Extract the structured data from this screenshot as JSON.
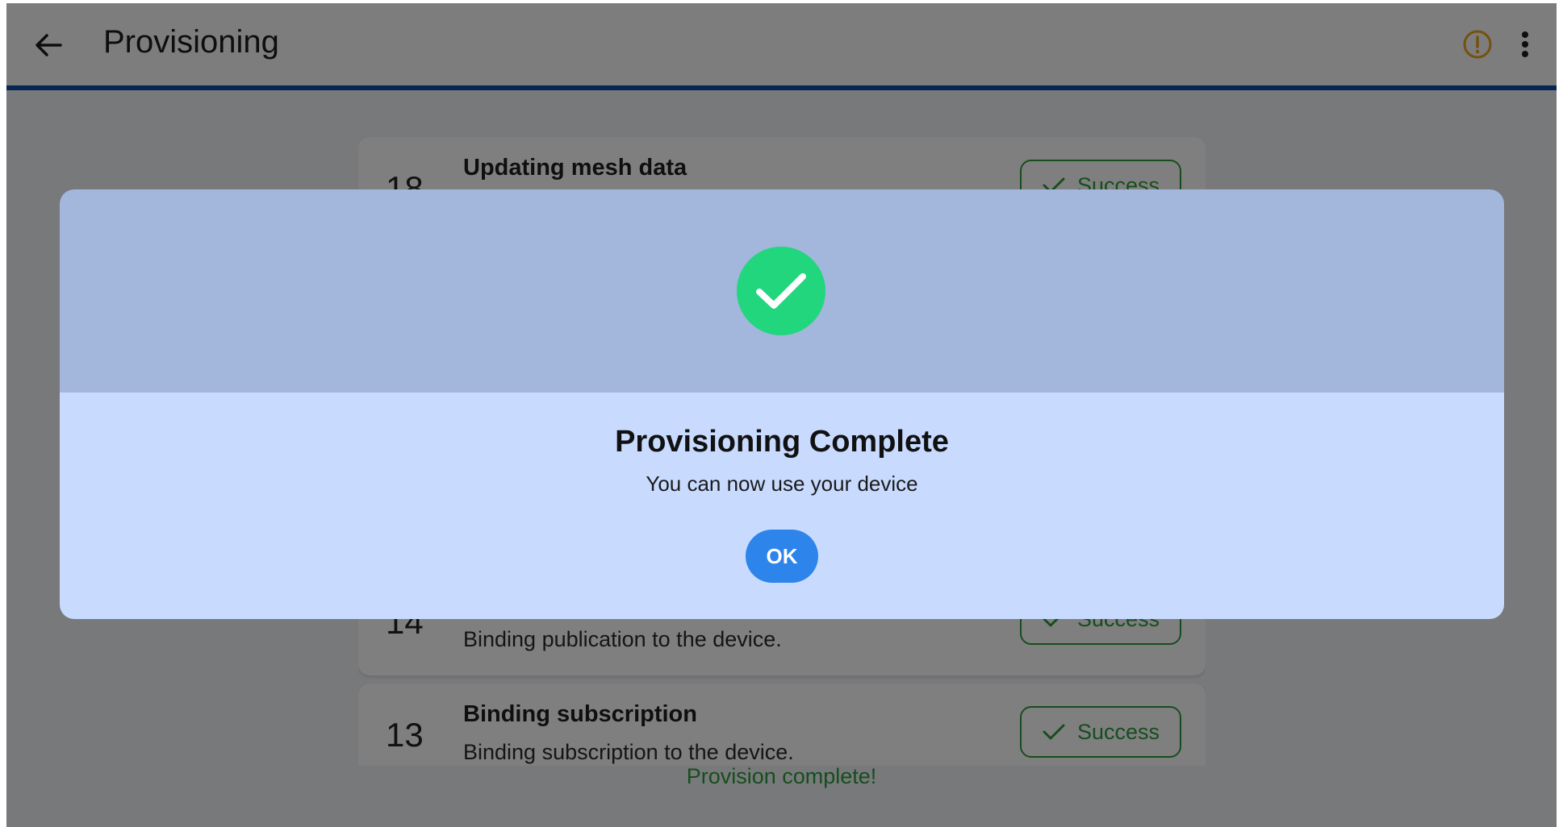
{
  "appbar": {
    "title": "Provisioning",
    "back_icon": "arrow-left-icon",
    "warning_icon": "warning-circle-icon",
    "more_icon": "more-vert-icon"
  },
  "steps": [
    {
      "number": "18",
      "title": "Updating mesh data",
      "subtitle": "",
      "status": "Success"
    },
    {
      "number": "14",
      "title": "",
      "subtitle": "Binding publication to the device.",
      "status": "Success"
    },
    {
      "number": "13",
      "title": "Binding subscription",
      "subtitle": "Binding subscription to the device.",
      "status": "Success"
    }
  ],
  "footer": {
    "status_text": "Provision complete!"
  },
  "dialog": {
    "icon": "check-circle-icon",
    "title": "Provisioning Complete",
    "message": "You can now use your device",
    "ok_label": "OK"
  },
  "colors": {
    "accent_bar": "#0a4aa8",
    "success": "#2e9b3d",
    "success_badge": "#21d67d",
    "warning": "#e8a21c",
    "ok_button": "#2d84ea",
    "dialog_header": "#a3b6dc",
    "dialog_body": "#c8dbff"
  }
}
